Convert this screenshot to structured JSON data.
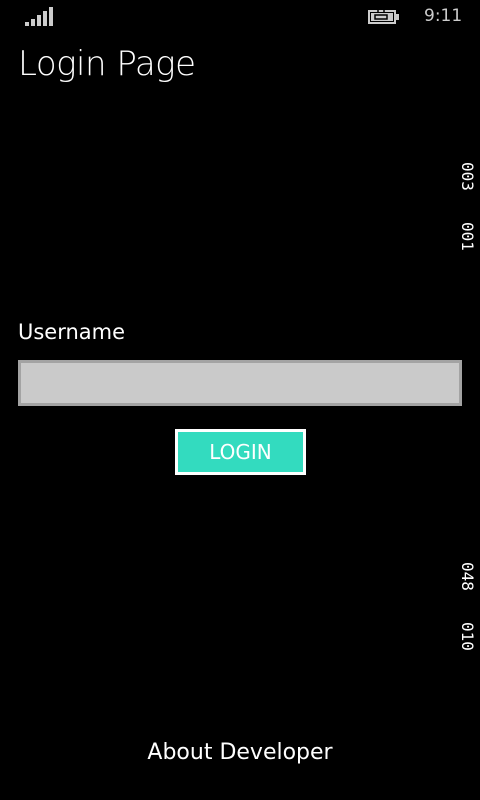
{
  "status_bar": {
    "time": "9:11",
    "signal_icon": "signal-bars-icon",
    "battery_icon": "battery-charging-icon",
    "signal_strength_bars": 5
  },
  "page": {
    "title": "Login Page"
  },
  "side_labels": {
    "top": [
      "003",
      "001"
    ],
    "bottom": [
      "048",
      "010"
    ]
  },
  "form": {
    "username_label": "Username",
    "username_value": "",
    "login_label": "LOGIN"
  },
  "footer": {
    "about_label": "About Developer"
  },
  "colors": {
    "accent": "#33dbbf",
    "input_bg": "#cacaca",
    "input_border": "#a3a3a3"
  }
}
